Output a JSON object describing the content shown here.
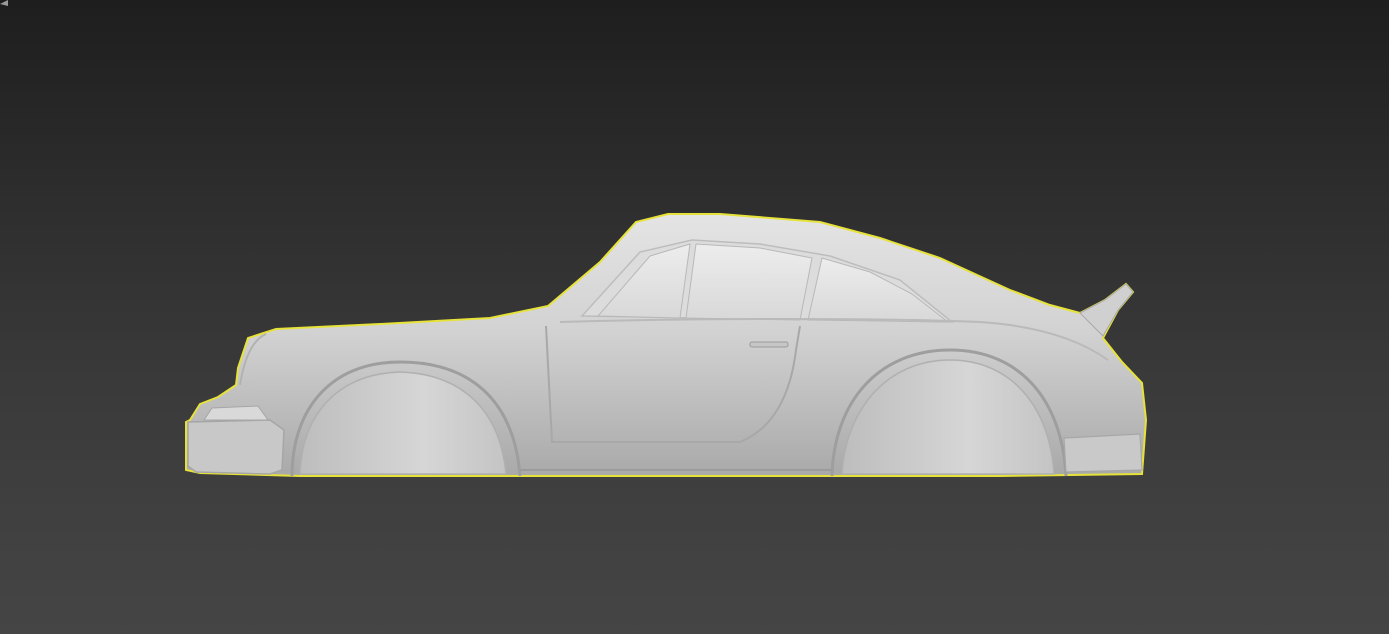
{
  "viewport": {
    "background_top": "#1e1e1e",
    "background_bottom": "#454545",
    "selection_outline_color": "#e6e23a",
    "model_color": "#cfcfcf",
    "object": "car-body-side-view",
    "selected": true
  }
}
